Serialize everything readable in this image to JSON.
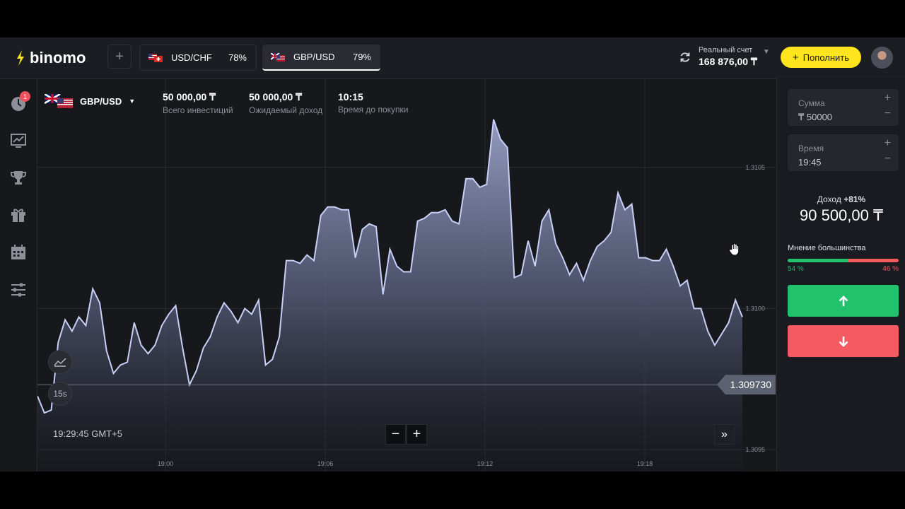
{
  "header": {
    "logo_text": "binomo",
    "add_tab_label": "+",
    "tabs": [
      {
        "name": "USD/CHF",
        "percent": "78%"
      },
      {
        "name": "GBP/USD",
        "percent": "79%"
      }
    ],
    "account": {
      "label": "Реальный счет",
      "balance": "168 876,00 ₸"
    },
    "deposit_label": "Пополнить"
  },
  "sidebar": {
    "notification_count": "1"
  },
  "chart": {
    "pair": "GBP/USD",
    "stats": [
      {
        "value": "50 000,00 ₸",
        "label": "Всего инвестиций"
      },
      {
        "value": "50 000,00 ₸",
        "label": "Ожидаемый доход"
      },
      {
        "value": "10:15",
        "label": "Время до покупки"
      }
    ],
    "current_price": "1.309730",
    "time_now": "19:29:45 GMT+5",
    "timeframe": "15s",
    "zoom_out": "−",
    "zoom_in": "+",
    "scroll_end": "»"
  },
  "chart_data": {
    "type": "area",
    "x_ticks": [
      "19:00",
      "19:06",
      "19:12",
      "19:18"
    ],
    "y_ticks": [
      "1.3105",
      "1.3100",
      "1.3095"
    ],
    "ylim": [
      1.30945,
      1.31075
    ],
    "series": [
      {
        "values": [
          1.30969,
          1.30963,
          1.30964,
          1.30988,
          1.30996,
          1.30992,
          1.30997,
          1.30994,
          1.31007,
          1.31002,
          1.30985,
          1.30977,
          1.3098,
          1.30981,
          1.30995,
          1.30987,
          1.30984,
          1.30987,
          1.30994,
          1.30998,
          1.31001,
          1.30986,
          1.30973,
          1.30978,
          1.30986,
          1.3099,
          1.30997,
          1.31002,
          1.30999,
          1.30995,
          1.31,
          1.30998,
          1.31003,
          1.3098,
          1.30982,
          1.3099,
          1.31017,
          1.31017,
          1.31016,
          1.31019,
          1.31017,
          1.31033,
          1.31036,
          1.31036,
          1.31035,
          1.31035,
          1.31018,
          1.31028,
          1.3103,
          1.31029,
          1.31005,
          1.31021,
          1.31015,
          1.31013,
          1.31013,
          1.31031,
          1.31032,
          1.31034,
          1.31034,
          1.31035,
          1.31031,
          1.3103,
          1.31046,
          1.31046,
          1.31043,
          1.31044,
          1.31067,
          1.3106,
          1.31057,
          1.31011,
          1.31012,
          1.31024,
          1.31015,
          1.31031,
          1.31035,
          1.31023,
          1.31018,
          1.31012,
          1.31016,
          1.3101,
          1.31017,
          1.31022,
          1.31024,
          1.31027,
          1.31041,
          1.31035,
          1.31037,
          1.31018,
          1.31018,
          1.31017,
          1.31017,
          1.31021,
          1.31015,
          1.31008,
          1.3101,
          1.31,
          1.31,
          1.30992,
          1.30987,
          1.30991,
          1.30995,
          1.31003,
          1.30997
        ]
      }
    ]
  },
  "panel": {
    "amount_label": "Сумма",
    "amount_value": "₸ 50000",
    "time_label": "Время",
    "time_value": "19:45",
    "income_label": "Доход",
    "income_pct": "+81%",
    "income_value": "90 500,00 ₸",
    "opinion_label": "Мнение большинства",
    "up_pct_text": "54 %",
    "down_pct_text": "46 %",
    "up_share": 54
  },
  "colors": {
    "up": "#20c36b",
    "down": "#f45b61",
    "accent": "#ffe41e",
    "line": "#c7cff6"
  }
}
